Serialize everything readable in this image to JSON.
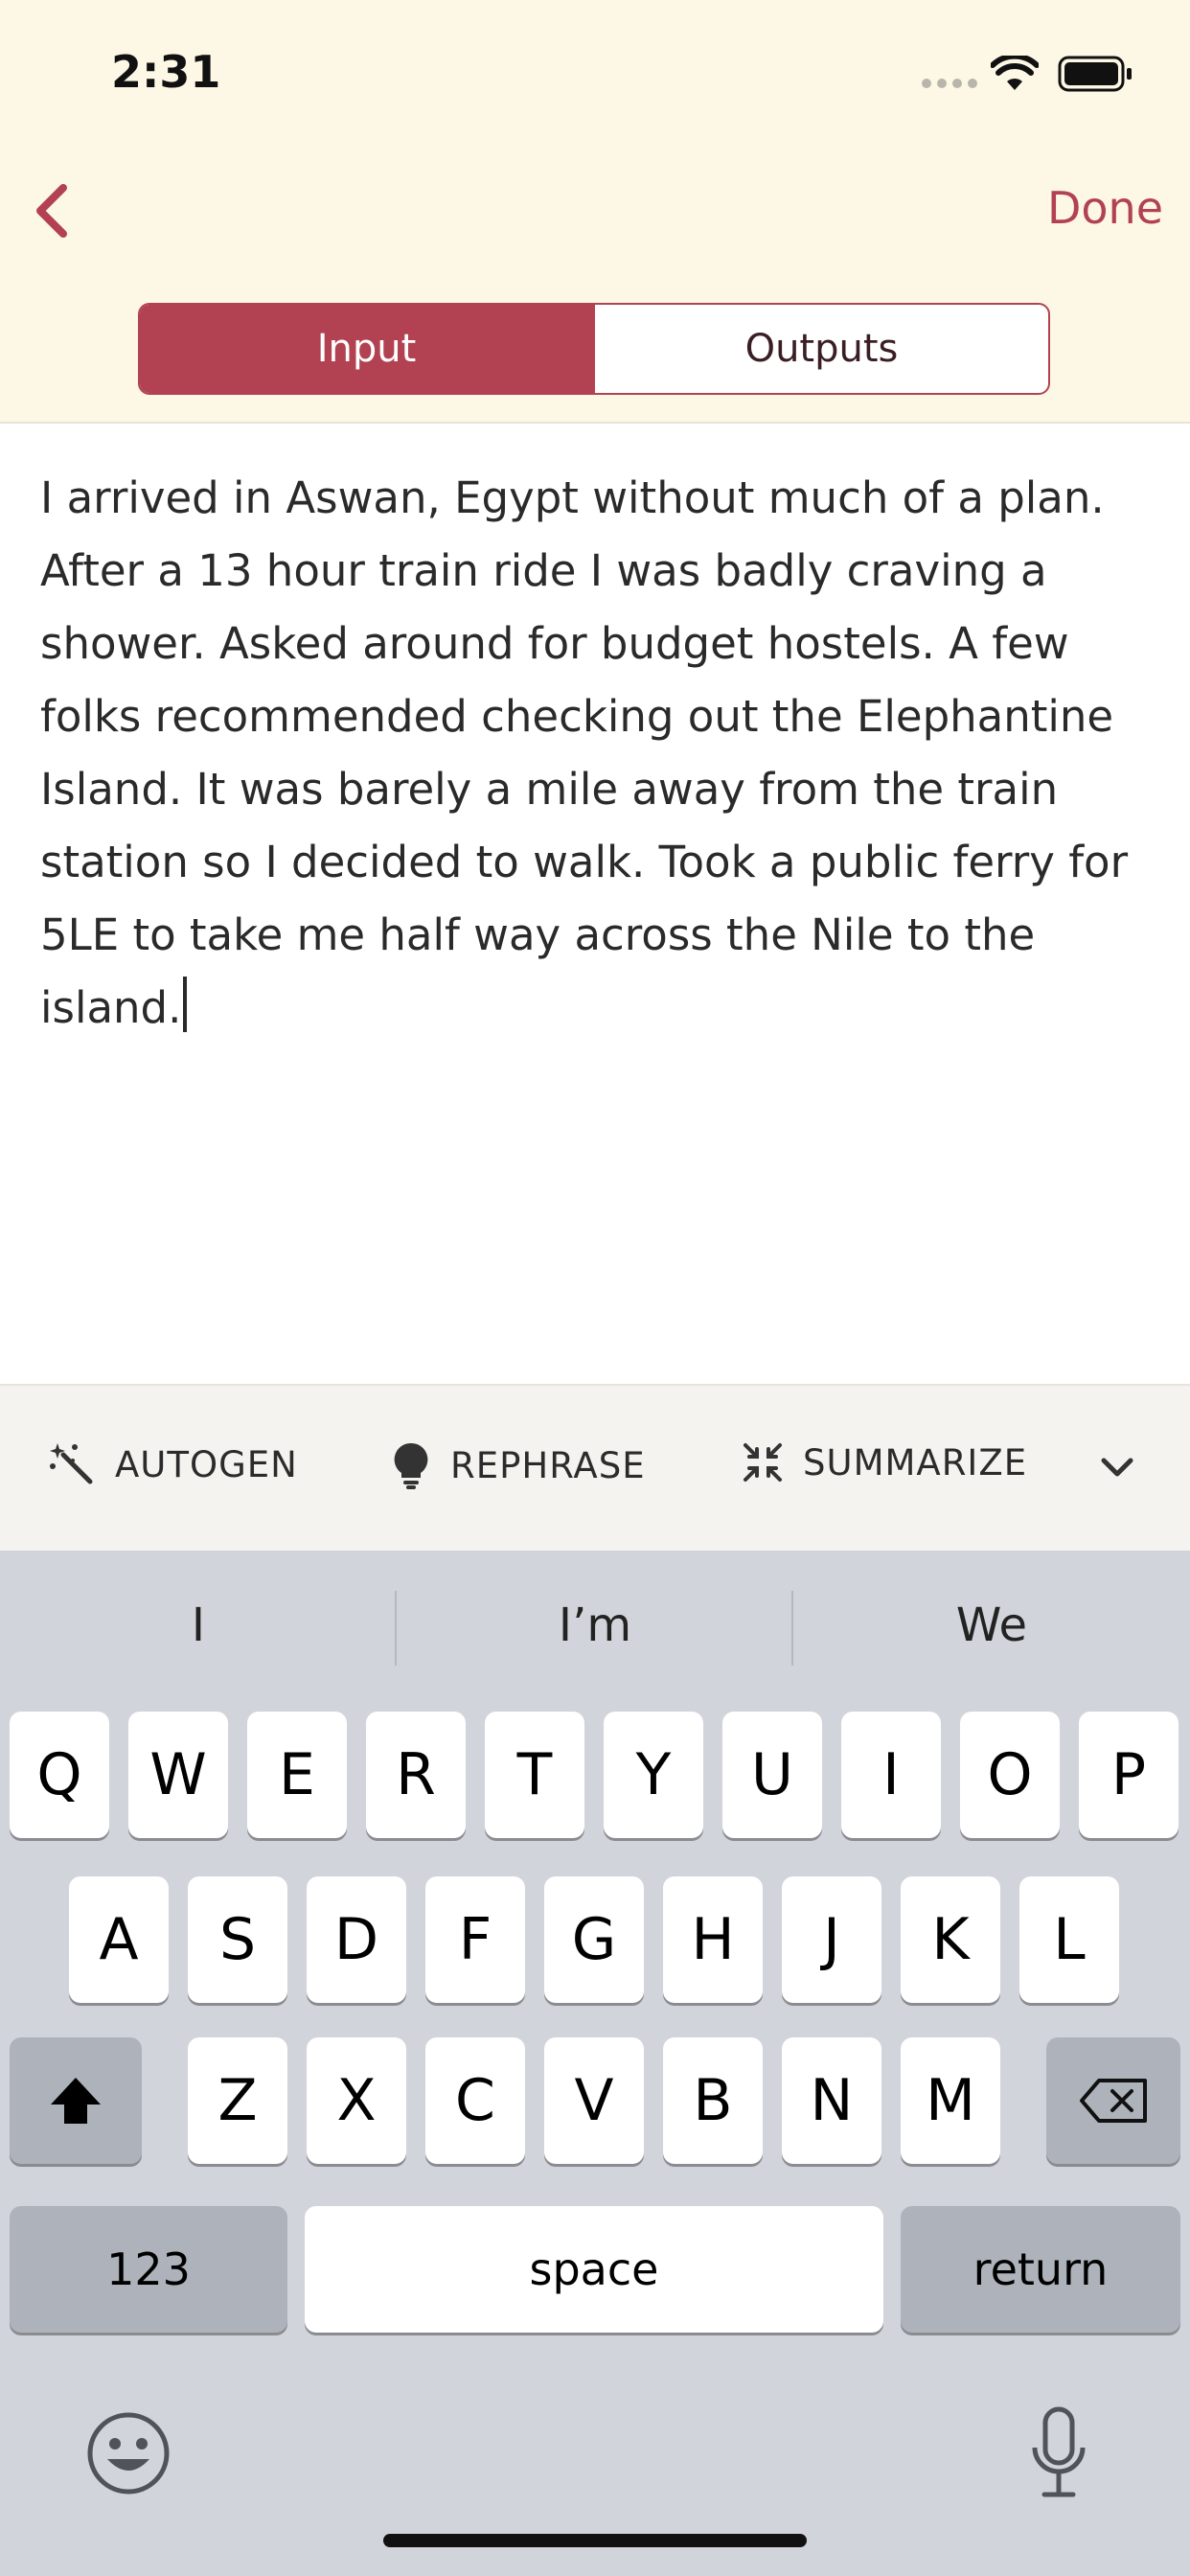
{
  "status_bar": {
    "time": "2:31"
  },
  "nav": {
    "back_icon": "chevron-left-icon",
    "done_label": "Done"
  },
  "segmented": {
    "input_label": "Input",
    "outputs_label": "Outputs"
  },
  "editor": {
    "text": "I arrived in Aswan, Egypt without much of a plan. After a 13 hour train ride I was badly craving a shower. Asked around for budget hostels. A few folks recommended checking out the Elephantine Island. It was barely a mile away from the train station so I decided to walk. Took a public ferry for 5LE to take me half way across the Nile to the island."
  },
  "toolbar": {
    "autogen_label": "AUTOGEN",
    "rephrase_label": "REPHRASE",
    "summarize_label": "SUMMARIZE"
  },
  "keyboard": {
    "suggestions": [
      "I",
      "I’m",
      "We"
    ],
    "row1": [
      "Q",
      "W",
      "E",
      "R",
      "T",
      "Y",
      "U",
      "I",
      "O",
      "P"
    ],
    "row2": [
      "A",
      "S",
      "D",
      "F",
      "G",
      "H",
      "J",
      "K",
      "L"
    ],
    "row3": [
      "Z",
      "X",
      "C",
      "V",
      "B",
      "N",
      "M"
    ],
    "numbers_label": "123",
    "space_label": "space",
    "return_label": "return"
  },
  "colors": {
    "accent": "#b24252",
    "background": "#fdf8e6",
    "keyboard": "#d1d4da"
  }
}
